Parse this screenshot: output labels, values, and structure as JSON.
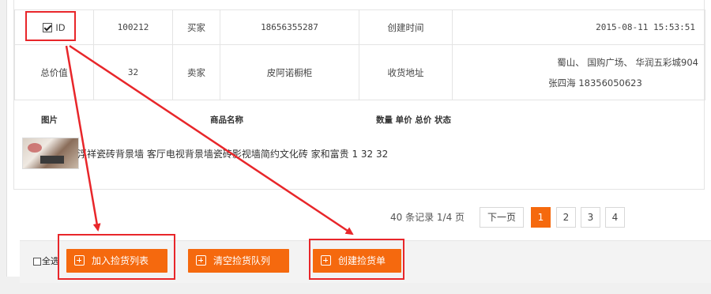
{
  "order": {
    "checked": true,
    "id_label": "ID",
    "id_value": "100212",
    "buyer_label": "买家",
    "buyer_value": "18656355287",
    "created_label": "创建时间",
    "created_value": "2015-08-11 15:53:51",
    "total_label": "总价值",
    "total_value": "32",
    "seller_label": "卖家",
    "seller_value": "皮阿诺橱柜",
    "address_label": "收货地址",
    "address_line1": "蜀山、 国购广场、 华润五彩城904",
    "address_line2": "张四海 18356050623"
  },
  "goods": {
    "headers": {
      "image": "图片",
      "name": "商品名称",
      "qty_price": "数量 单价 总价 状态"
    },
    "row_text": "浮祥瓷砖背景墙  客厅电视背景墙瓷砖影视墙简约文化砖  家和富贵  1   32  32"
  },
  "pagination": {
    "info": "40 条记录 1/4 页",
    "next_label": "下一页",
    "pages": [
      "1",
      "2",
      "3",
      "4"
    ],
    "active_page": "1"
  },
  "footer": {
    "select_all_label": "全选",
    "add_pick_list_label": "加入捡货列表",
    "clear_pick_queue_label": "清空捡货队列",
    "create_pick_order_label": "创建捡货单"
  },
  "colors": {
    "accent": "#f5690e",
    "annotation_red": "#e8262a"
  }
}
